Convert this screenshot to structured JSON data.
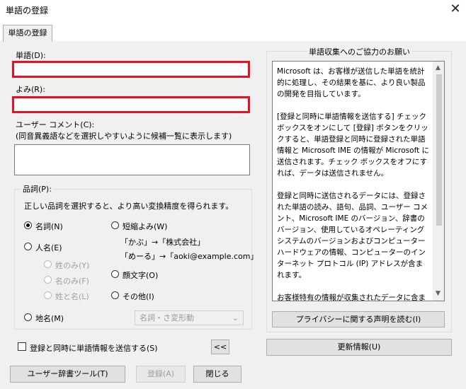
{
  "window": {
    "title": "単語の登録",
    "close_glyph": "✕"
  },
  "tab": {
    "label": "単語の登録"
  },
  "word": {
    "label": "単語(D):",
    "value": ""
  },
  "reading": {
    "label": "よみ(R):",
    "value": ""
  },
  "comment": {
    "label": "ユーザー コメント(C):",
    "hint": "(同音異義語などを選択しやすいように候補一覧に表示します)",
    "value": ""
  },
  "pos": {
    "legend": "品詞(P):",
    "hint": "正しい品詞を選択すると、より高い変換精度を得られます。",
    "noun": "名詞(N)",
    "person": "人名(E)",
    "surname": "姓のみ(Y)",
    "given": "名のみ(F)",
    "fullname": "姓と名(L)",
    "place": "地名(M)",
    "short": "短縮よみ(W)",
    "example1": "「かぶ」→「株式会社」",
    "example2": "「めーる」→「aoki@example.com」",
    "emoticon": "顔文字(O)",
    "other": "その他(I)",
    "select_value": "名詞・さ変形動"
  },
  "send_checkbox": {
    "label": "登録と同時に単語情報を送信する(S)",
    "checked": false
  },
  "collapse_button": "<<",
  "info": {
    "legend": "単語収集へのご協力のお願い",
    "paragraphs": [
      "Microsoft は、お客様が送信した単語を統計的に処理し、その結果を基に、より良い製品の開発を目指しています。",
      "[登録と同時に単語情報を送信する] チェック ボックスをオンにして [登録] ボタンをクリックすると、単語登録と同時に登録された単語情報と Microsoft IME の情報が Microsoft に送信されます。チェック ボックスをオフにすれば、データは送信されません。",
      "登録と同時に送信されるデータには、登録された単語の読み、語句、品詞、ユーザー コメント、Microsoft IME のバージョン、辞書のバージョン、使用しているオペレーティング システムのバージョンおよびコンピューター ハードウェアの情報、コンピューターのインターネット プロトコル (IP) アドレスが含まれます。",
      "お客様特有の情報が収集されたデータに含まれることがあります。このような情報が存在する場合でも、Microsoft では、お客様を特定するために使用することはありません。"
    ],
    "privacy_button": "プライバシーに関する声明を読む(I)",
    "update_button": "更新情報(U)"
  },
  "footer": {
    "dict_tool": "ユーザー辞書ツール(T)",
    "register": "登録(A)",
    "close": "閉じる"
  }
}
